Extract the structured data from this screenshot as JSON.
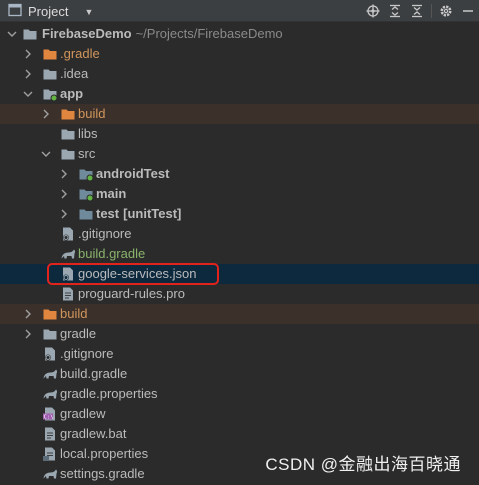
{
  "toolbar": {
    "title": "Project",
    "icons": [
      "project-window-icon",
      "locate-icon",
      "expand-all-icon",
      "collapse-all-icon",
      "settings-icon",
      "hide-icon"
    ]
  },
  "tree": {
    "root_name": "FirebaseDemo",
    "root_path": "~/Projects/FirebaseDemo",
    "rows": [
      {
        "label": ".gradle",
        "icon": "folder-orange-icon"
      },
      {
        "label": ".idea",
        "icon": "folder-icon"
      },
      {
        "label": "app",
        "icon": "module-folder-icon"
      },
      {
        "label": "build",
        "icon": "folder-orange-icon"
      },
      {
        "label": "libs",
        "icon": "folder-icon"
      },
      {
        "label": "src",
        "icon": "folder-icon"
      },
      {
        "label": "androidTest",
        "icon": "source-folder-icon"
      },
      {
        "label": "main",
        "icon": "source-folder-icon"
      },
      {
        "label": "test",
        "suffix": "[unitTest]",
        "icon": "source-folder-icon"
      },
      {
        "label": ".gitignore",
        "icon": "gitignore-file-icon"
      },
      {
        "label": "build.gradle",
        "icon": "gradle-file-icon"
      },
      {
        "label": "google-services.json",
        "icon": "json-file-icon"
      },
      {
        "label": "proguard-rules.pro",
        "icon": "text-file-icon"
      },
      {
        "label": "build",
        "icon": "folder-orange-icon"
      },
      {
        "label": "gradle",
        "icon": "folder-icon"
      },
      {
        "label": ".gitignore",
        "icon": "gitignore-file-icon"
      },
      {
        "label": "build.gradle",
        "icon": "gradle-file-icon"
      },
      {
        "label": "gradle.properties",
        "icon": "gradle-file-icon"
      },
      {
        "label": "gradlew",
        "icon": "shell-file-icon"
      },
      {
        "label": "gradlew.bat",
        "icon": "text-file-icon"
      },
      {
        "label": "local.properties",
        "icon": "properties-file-icon"
      },
      {
        "label": "settings.gradle",
        "icon": "gradle-file-icon"
      }
    ]
  },
  "selected": "google-services.json",
  "watermark": "CSDN @金融出海百晓通",
  "colors": {
    "selection": "#0d293e",
    "excluded_row": "#3b312a",
    "highlight_box": "#e2231b",
    "module_dot": "#62b543"
  }
}
